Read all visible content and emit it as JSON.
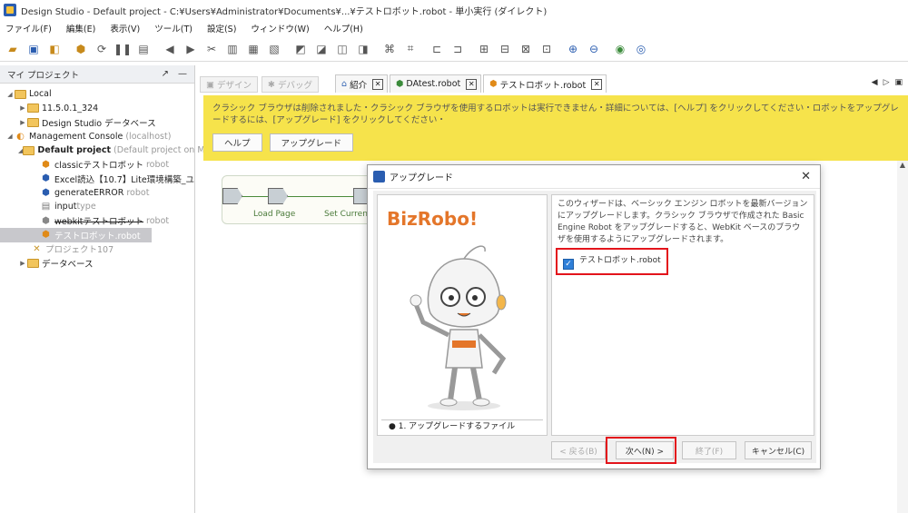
{
  "window": {
    "title": "Design Studio - Default project - C:¥Users¥Administrator¥Documents¥...¥テストロボット.robot - 単小実行 (ダイレクト)"
  },
  "menu": [
    "ファイル(F)",
    "編集(E)",
    "表示(V)",
    "ツール(T)",
    "設定(S)",
    "ウィンドウ(W)",
    "ヘルプ(H)"
  ],
  "left_panel": {
    "title": "マイ プロジェクト",
    "tree": [
      {
        "label": "Local",
        "suffix": ""
      },
      {
        "label": "11.5.0.1_324",
        "suffix": ""
      },
      {
        "label": "Design Studio データベース",
        "suffix": ""
      },
      {
        "label": "Management Console",
        "suffix": "(localhost)"
      },
      {
        "label": "Default project",
        "suffix": "(Default project on M"
      },
      {
        "label": "classicテストロボット",
        "suffix": "robot"
      },
      {
        "label": "Excel読込【10.7】Lite環境構築_ユ",
        "suffix": ""
      },
      {
        "label": "generateERROR",
        "suffix": "robot"
      },
      {
        "label": "input",
        "suffix": "type"
      },
      {
        "label": "webkitテストロボット",
        "suffix": "robot"
      },
      {
        "label": "テストロボット.robot",
        "suffix": ""
      },
      {
        "label": "プロジェクト107",
        "suffix": ""
      },
      {
        "label": "データベース",
        "suffix": ""
      }
    ]
  },
  "tabs": {
    "design": "デザイン",
    "debug": "デバッグ",
    "files": [
      "紹介",
      "DAtest.robot",
      "テストロボット.robot"
    ]
  },
  "warning": {
    "message": "クラシック ブラウザは削除されました・クラシック ブラウザを使用するロボットは実行できません・詳細については、[ヘルプ] をクリックしてください・ロボットをアップグレードするには、[アップグレード] をクリックしてください・",
    "help_label": "ヘルプ",
    "upgrade_label": "アップグレード"
  },
  "flow": {
    "load_page": "Load Page",
    "set_current": "Set Current"
  },
  "dialog": {
    "title": "アップグレード",
    "brand": "BizRobo!",
    "step": "● 1. アップグレードするファイル",
    "description": "このウィザードは、ベーシック エンジン ロボットを最新バージョンにアップグレードします。クラシック ブラウザで作成された Basic Engine Robot をアップグレードすると、WebKit ベースのブラウザを使用するようにアップグレードされます。",
    "checkbox_label": "テストロボット.robot",
    "checked": true,
    "buttons": {
      "back": "< 戻る(B)",
      "next": "次へ(N) >",
      "finish": "終了(F)",
      "cancel": "キャンセル(C)"
    }
  }
}
